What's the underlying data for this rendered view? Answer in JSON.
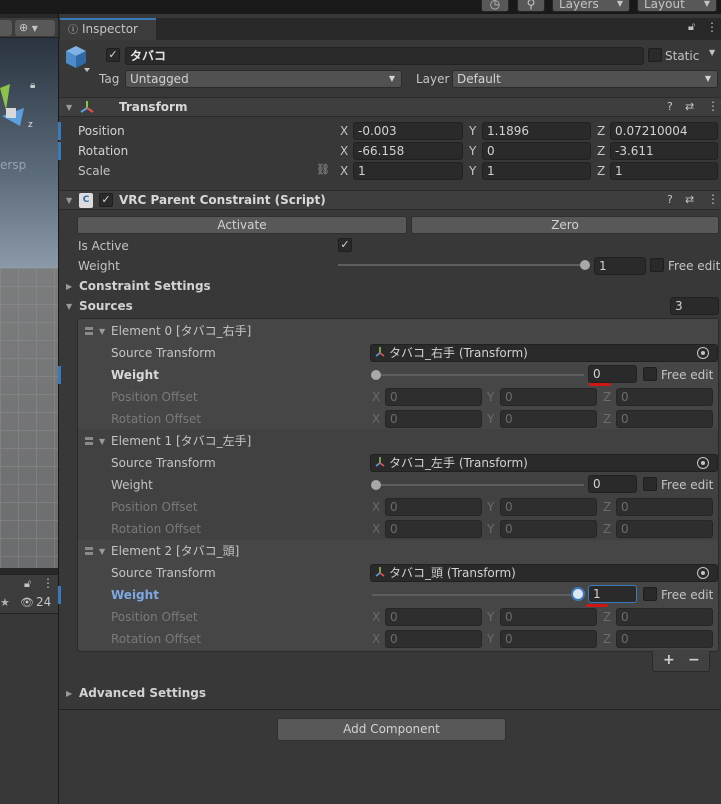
{
  "toolbar": {
    "history_icon": "history-icon",
    "search_icon": "search-icon",
    "layers_label": "Layers",
    "layout_label": "Layout"
  },
  "scene": {
    "view_label": "ersp",
    "hidden_count": "24"
  },
  "inspector": {
    "tab_label": "Inspector",
    "gameobject": {
      "name": "タバコ",
      "active": true,
      "static_label": "Static",
      "tag_label": "Tag",
      "tag_value": "Untagged",
      "layer_label": "Layer",
      "layer_value": "Default"
    },
    "transform": {
      "title": "Transform",
      "position_label": "Position",
      "rotation_label": "Rotation",
      "scale_label": "Scale",
      "axis_x": "X",
      "axis_y": "Y",
      "axis_z": "Z",
      "position": {
        "x": "-0.003",
        "y": "1.1896",
        "z": "0.07210004"
      },
      "rotation": {
        "x": "-66.158",
        "y": "0",
        "z": "-3.611"
      },
      "scale": {
        "x": "1",
        "y": "1",
        "z": "1"
      }
    },
    "constraint": {
      "title": "VRC Parent Constraint (Script)",
      "activate_label": "Activate",
      "zero_label": "Zero",
      "is_active_label": "Is Active",
      "is_active": true,
      "weight_label": "Weight",
      "weight_value": "1",
      "weight_level": 1.0,
      "free_edit_label": "Free edit",
      "constraint_settings_label": "Constraint Settings",
      "sources_label": "Sources",
      "sources_count": "3",
      "source_transform_label": "Source Transform",
      "position_offset_label": "Position Offset",
      "rotation_offset_label": "Rotation Offset",
      "offset_zero": "0",
      "elements": [
        {
          "title": "Element 0 [タバコ_右手]",
          "source": "タバコ_右手 (Transform)",
          "weight": "0",
          "weight_level": 0.0
        },
        {
          "title": "Element 1 [タバコ_左手]",
          "source": "タバコ_左手 (Transform)",
          "weight": "0",
          "weight_level": 0.0
        },
        {
          "title": "Element 2 [タバコ_頭]",
          "source": "タバコ_頭 (Transform)",
          "weight": "1",
          "weight_level": 1.0
        }
      ],
      "add_label": "+",
      "remove_label": "−",
      "advanced_settings_label": "Advanced Settings"
    },
    "add_component_label": "Add Component"
  },
  "colors": {
    "accent": "#3a79bb",
    "annotation_red": "#d11616",
    "panel_bg": "#383838"
  }
}
